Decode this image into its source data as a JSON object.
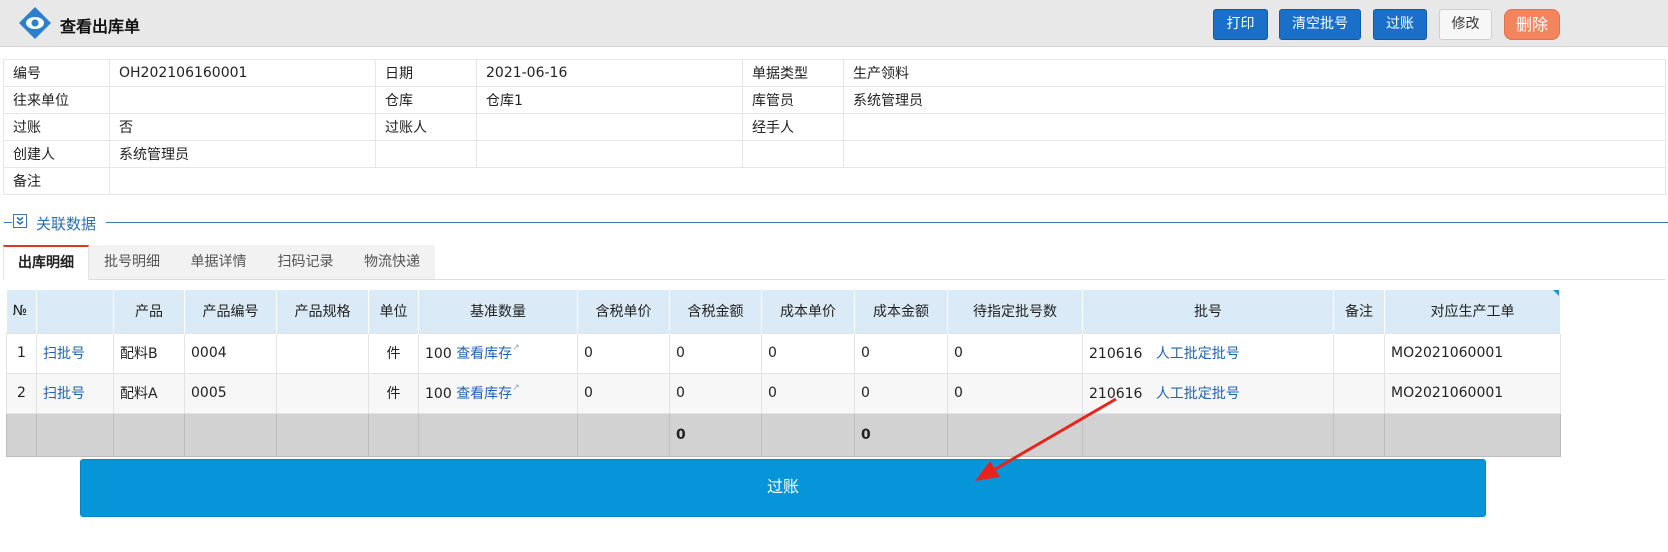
{
  "header": {
    "title": "查看出库单",
    "buttons": {
      "print": "打印",
      "clear_batch": "清空批号",
      "post": "过账",
      "edit": "修改",
      "delete": "删除"
    }
  },
  "info": {
    "labels": {
      "code": "编号",
      "date": "日期",
      "doc_type": "单据类型",
      "partner": "往来单位",
      "warehouse": "仓库",
      "keeper": "库管员",
      "posted": "过账",
      "poster": "过账人",
      "handler": "经手人",
      "creator": "创建人",
      "remark": "备注"
    },
    "values": {
      "code": "OH202106160001",
      "date": "2021-06-16",
      "doc_type": "生产领料",
      "partner": "",
      "warehouse": "仓库1",
      "keeper": "系统管理员",
      "posted": "否",
      "poster": "",
      "handler": "",
      "creator": "系统管理员",
      "remark": ""
    }
  },
  "section": {
    "title": "关联数据"
  },
  "tabs": [
    "出库明细",
    "批号明细",
    "单据详情",
    "扫码记录",
    "物流快递"
  ],
  "grid": {
    "columns": [
      "№",
      "",
      "产品",
      "产品编号",
      "产品规格",
      "单位",
      "基准数量",
      "含税单价",
      "含税金额",
      "成本单价",
      "成本金额",
      "待指定批号数",
      "批号",
      "备注",
      "对应生产工单"
    ],
    "rows": [
      {
        "no": "1",
        "scan": "扫批号",
        "product": "配料B",
        "code": "0004",
        "spec": "",
        "unit": "件",
        "qty": "100",
        "stock_link": "查看库存",
        "tax_price": "0",
        "tax_amount": "0",
        "cost_price": "0",
        "cost_amount": "0",
        "pending": "0",
        "batch": "210616",
        "batch_link": "人工批定批号",
        "remark": "",
        "work_order": "MO2021060001"
      },
      {
        "no": "2",
        "scan": "扫批号",
        "product": "配料A",
        "code": "0005",
        "spec": "",
        "unit": "件",
        "qty": "100",
        "stock_link": "查看库存",
        "tax_price": "0",
        "tax_amount": "0",
        "cost_price": "0",
        "cost_amount": "0",
        "pending": "0",
        "batch": "210616",
        "batch_link": "人工批定批号",
        "remark": "",
        "work_order": "MO2021060001"
      }
    ],
    "totals": {
      "tax_amount": "0",
      "cost_amount": "0"
    }
  },
  "post_button": "过账",
  "colors": {
    "primary": "#1a6fc9",
    "big_button": "#0795da",
    "delete": "#f2855e",
    "link": "#1e64b4",
    "annotation_arrow": "#e8231b"
  },
  "icons": {
    "logo": "eye-icon",
    "collapse": "double-chevron-down-icon",
    "external": "external-link-icon"
  }
}
